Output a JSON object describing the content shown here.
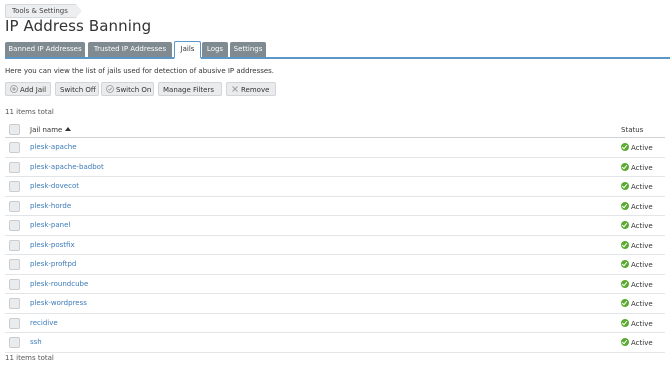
{
  "breadcrumb": {
    "label": "Tools & Settings"
  },
  "page": {
    "title": "IP Address Banning",
    "description": "Here you can view the list of jails used for detection of abusive IP addresses."
  },
  "tabs": [
    {
      "label": "Banned IP Addresses"
    },
    {
      "label": "Trusted IP Addresses"
    },
    {
      "label": "Jails",
      "active": true
    },
    {
      "label": "Logs"
    },
    {
      "label": "Settings"
    }
  ],
  "toolbar": {
    "add_jail": "Add Jail",
    "switch_off": "Switch Off",
    "switch_on": "Switch On",
    "manage_filters": "Manage Filters",
    "remove": "Remove"
  },
  "totals": {
    "top": "11 items total",
    "bottom": "11 items total"
  },
  "table": {
    "columns": {
      "name": "Jail name",
      "status": "Status"
    },
    "rows": [
      {
        "name": "plesk-apache",
        "status": "Active"
      },
      {
        "name": "plesk-apache-badbot",
        "status": "Active"
      },
      {
        "name": "plesk-dovecot",
        "status": "Active"
      },
      {
        "name": "plesk-horde",
        "status": "Active"
      },
      {
        "name": "plesk-panel",
        "status": "Active"
      },
      {
        "name": "plesk-postfix",
        "status": "Active"
      },
      {
        "name": "plesk-proftpd",
        "status": "Active"
      },
      {
        "name": "plesk-roundcube",
        "status": "Active"
      },
      {
        "name": "plesk-wordpress",
        "status": "Active"
      },
      {
        "name": "recidive",
        "status": "Active"
      },
      {
        "name": "ssh",
        "status": "Active"
      }
    ]
  },
  "colors": {
    "link": "#3a7ab9",
    "tab_inactive": "#7f8a91",
    "tab_border": "#5b97c7",
    "active_status": "#5aa930"
  }
}
